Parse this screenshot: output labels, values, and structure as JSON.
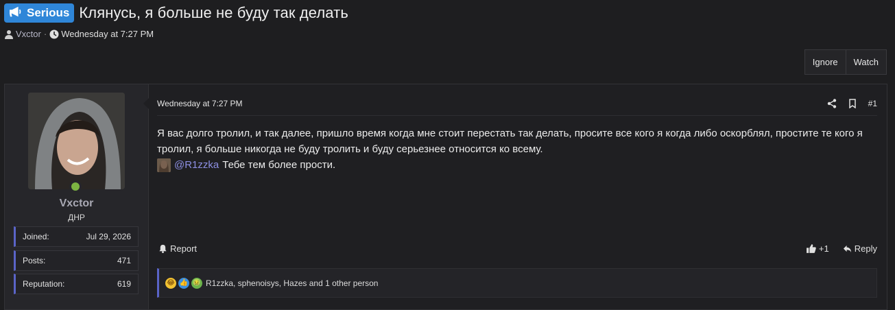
{
  "thread": {
    "prefix": "Serious",
    "title": "Клянусь, я больше не буду так делать",
    "author": "Vxctor",
    "date": "Wednesday at 7:27 PM"
  },
  "actions": {
    "ignore": "Ignore",
    "watch": "Watch"
  },
  "post": {
    "date": "Wednesday at 7:27 PM",
    "number": "#1",
    "body": "Я вас долго тролил, и так далее, пришло время когда мне стоит перестать так делать, просите все кого я когда либо оскорблял, простите те кого я тролил, я больше никогда не буду тролить и буду серьезнее относится ко всему.",
    "mention": "@R1zzka",
    "mention_text": "Тебе тем более прости.",
    "report": "Report",
    "like_count": "+1",
    "reply": "Reply",
    "reactions_text": "R1zzka, sphenoisys, Hazes and 1 other person"
  },
  "user": {
    "name": "Vxctor",
    "title": "ДНР",
    "stats": [
      {
        "label": "Joined:",
        "value": "Jul 29, 2026"
      },
      {
        "label": "Posts:",
        "value": "471"
      },
      {
        "label": "Reputation:",
        "value": "619"
      }
    ]
  },
  "colors": {
    "accent": "#5a64c8",
    "prefix": "#2f86d8",
    "online": "#7cb342",
    "mention": "#8d8fe3"
  }
}
